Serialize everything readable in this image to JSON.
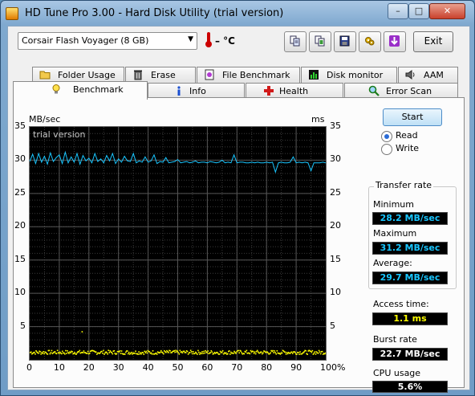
{
  "window": {
    "title": "HD Tune Pro 3.00 - Hard Disk Utility (trial version)",
    "minimize": "–",
    "maximize": "□",
    "close": "✕"
  },
  "toolbar": {
    "drive": "Corsair Flash Voyager (8 GB)",
    "temperature": "– °C",
    "buttons": [
      "copy-info-icon",
      "copy-screenshot-icon",
      "save-icon",
      "options-icon",
      "download-icon"
    ],
    "exit_label": "Exit"
  },
  "tabs_top": [
    {
      "label": "Folder Usage",
      "icon": "folder-icon"
    },
    {
      "label": "Erase",
      "icon": "trash-icon"
    },
    {
      "label": "File Benchmark",
      "icon": "file-benchmark-icon"
    },
    {
      "label": "Disk monitor",
      "icon": "disk-monitor-icon"
    },
    {
      "label": "AAM",
      "icon": "speaker-icon"
    }
  ],
  "tabs_bottom": [
    {
      "label": "Benchmark",
      "icon": "lightbulb-icon",
      "active": true
    },
    {
      "label": "Info",
      "icon": "info-icon"
    },
    {
      "label": "Health",
      "icon": "health-cross-icon"
    },
    {
      "label": "Error Scan",
      "icon": "magnifier-icon"
    }
  ],
  "benchmark": {
    "start_label": "Start",
    "mode_read": "Read",
    "mode_write": "Write",
    "selected_mode": "read",
    "transfer_rate_title": "Transfer rate",
    "minimum_label": "Minimum",
    "minimum": "28.2 MB/sec",
    "maximum_label": "Maximum",
    "maximum": "31.2 MB/sec",
    "average_label": "Average:",
    "average": "29.7 MB/sec",
    "access_time_label": "Access time:",
    "access_time": "1.1 ms",
    "burst_rate_label": "Burst rate",
    "burst_rate": "22.7 MB/sec",
    "cpu_usage_label": "CPU usage",
    "cpu_usage": "5.6%"
  },
  "chart_data": {
    "type": "line",
    "watermark": "trial version",
    "ylabel_left": "MB/sec",
    "ylabel_right": "ms",
    "xlim": [
      0,
      100
    ],
    "ylim": [
      0,
      35
    ],
    "y_ticks": [
      "35",
      "30",
      "25",
      "20",
      "15",
      "10",
      "5"
    ],
    "x_ticks": [
      "0",
      "10",
      "20",
      "30",
      "40",
      "50",
      "60",
      "70",
      "80",
      "90",
      "100%"
    ],
    "grid": true,
    "series": [
      {
        "name": "transfer rate",
        "color": "#19c6ff",
        "x": [
          0,
          1,
          2,
          3,
          4,
          5,
          6,
          7,
          8,
          9,
          10,
          11,
          12,
          13,
          14,
          15,
          16,
          17,
          18,
          19,
          20,
          21,
          22,
          23,
          24,
          25,
          26,
          27,
          28,
          29,
          30,
          31,
          32,
          33,
          34,
          35,
          36,
          37,
          38,
          39,
          40,
          41,
          42,
          43,
          44,
          45,
          46,
          47,
          48,
          49,
          50,
          51,
          52,
          53,
          54,
          55,
          56,
          57,
          58,
          59,
          60,
          61,
          62,
          63,
          64,
          65,
          66,
          67,
          68,
          69,
          70,
          71,
          72,
          73,
          74,
          75,
          76,
          77,
          78,
          79,
          80,
          81,
          82,
          83,
          84,
          85,
          86,
          87,
          88,
          89,
          90,
          91,
          92,
          93,
          94,
          95,
          96,
          97,
          98,
          99,
          100
        ],
        "values": [
          29.8,
          30.9,
          29.5,
          31.0,
          29.7,
          30.6,
          29.4,
          31.1,
          29.8,
          30.4,
          30.8,
          29.5,
          31.2,
          29.6,
          30.5,
          29.7,
          31.0,
          29.4,
          30.7,
          29.9,
          30.3,
          29.6,
          31.0,
          29.8,
          30.2,
          29.6,
          30.7,
          29.9,
          31.0,
          29.5,
          30.2,
          29.7,
          30.6,
          29.9,
          29.8,
          31.0,
          29.6,
          29.9,
          29.7,
          30.5,
          29.7,
          29.9,
          30.8,
          29.5,
          29.8,
          29.7,
          30.4,
          29.6,
          29.7,
          29.8,
          30.1,
          29.6,
          29.7,
          29.8,
          29.6,
          29.7,
          29.9,
          29.6,
          29.7,
          29.7,
          29.6,
          29.8,
          29.7,
          29.6,
          29.7,
          30.0,
          29.6,
          29.7,
          29.6,
          30.8,
          29.6,
          29.7,
          29.7,
          29.6,
          29.6,
          29.7,
          29.6,
          29.7,
          29.6,
          29.6,
          29.7,
          29.6,
          29.7,
          28.2,
          29.6,
          29.7,
          29.6,
          29.6,
          29.7,
          30.5,
          29.6,
          29.7,
          29.6,
          29.7,
          29.6,
          28.4,
          29.6,
          29.6,
          29.6,
          29.7,
          29.6
        ]
      },
      {
        "name": "access time",
        "color": "#ffff00",
        "type": "scatter",
        "y_axis": "right",
        "typical_value": 1.1,
        "x_range": [
          0,
          100
        ],
        "outlier": {
          "x": 17.5,
          "y": 4.2
        }
      }
    ]
  }
}
